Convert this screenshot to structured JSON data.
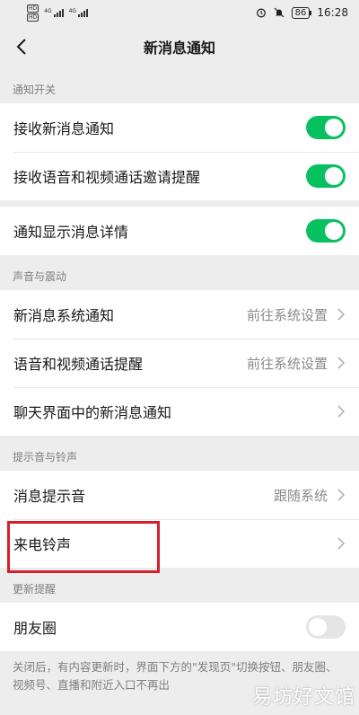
{
  "status_bar": {
    "sim1": "HD",
    "sim2": "HD",
    "net1": "4G",
    "net2": "4G",
    "battery": "86",
    "time": "16:28",
    "alarm_icon": "alarm-icon",
    "mute_icon": "bell-off-icon"
  },
  "nav": {
    "title": "新消息通知",
    "back_icon": "back-arrow-icon"
  },
  "sections": {
    "notify_switch": {
      "label": "通知开关",
      "items": [
        {
          "label": "接收新消息通知",
          "on": true
        },
        {
          "label": "接收语音和视频通话邀请提醒",
          "on": true
        }
      ],
      "detail": {
        "label": "通知显示消息详情",
        "on": true
      }
    },
    "sound_vibration": {
      "label": "声音与震动",
      "items": [
        {
          "label": "新消息系统通知",
          "value": "前往系统设置"
        },
        {
          "label": "语音和视频通话提醒",
          "value": "前往系统设置"
        },
        {
          "label": "聊天界面中的新消息通知",
          "value": ""
        }
      ]
    },
    "tone_ringtone": {
      "label": "提示音与铃声",
      "items": [
        {
          "label": "消息提示音",
          "value": "跟随系统"
        },
        {
          "label": "来电铃声",
          "value": ""
        }
      ]
    },
    "update_reminder": {
      "label": "更新提醒",
      "items": [
        {
          "label": "朋友圈",
          "on": false
        }
      ],
      "note": "关闭后，有内容更新时，界面下方的\"发现页\"切换按钮、朋友圈、视频号、直播和附近入口不再出"
    }
  },
  "watermark": "易坊好文馆",
  "colors": {
    "toggle_on": "#07c160",
    "toggle_off": "#e5e5e5",
    "highlight": "#d51f2b"
  }
}
